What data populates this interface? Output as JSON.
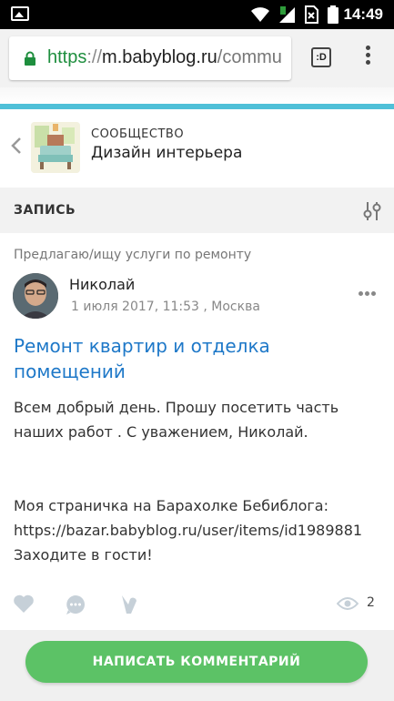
{
  "status_bar": {
    "time": "14:49",
    "icons": [
      "gallery-icon",
      "wifi-icon",
      "signal-icon",
      "no-sim-icon",
      "battery-icon"
    ]
  },
  "browser": {
    "url_scheme": "https",
    "url_separator": "://",
    "url_host": "m.babyblog.ru",
    "url_path": "/commu",
    "tabs_label": ":D"
  },
  "community": {
    "type_label": "СООБЩЕСТВО",
    "name": "Дизайн интерьера"
  },
  "section": {
    "title": "ЗАПИСЬ"
  },
  "post": {
    "category": "Предлагаю/ищу услуги по ремонту",
    "author": "Николай",
    "meta": "1 июля 2017, 11:53 , Москва",
    "title": "Ремонт квартир и отделка помещений",
    "text_line1": "Всем добрый день. Прошу посетить часть",
    "text_line2": "наших работ . С уважением, Николай.",
    "text_line3": "Моя страничка на Барахолке Бебиблога:",
    "text_line4": "https://bazar.babyblog.ru/user/items/id1989881",
    "text_line5": "Заходите в гости!",
    "views": "2"
  },
  "actions": {
    "comment_button_label": "НАПИСАТЬ КОММЕНТАРИЙ"
  },
  "colors": {
    "accent_line": "#4fc0d8",
    "title_link": "#1e78c8",
    "button_green": "#5cc266",
    "url_green": "#1e8e3e"
  }
}
